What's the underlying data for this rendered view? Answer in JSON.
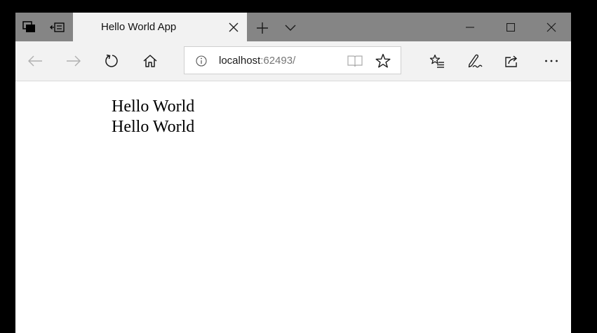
{
  "tab": {
    "title": "Hello World App"
  },
  "address": {
    "host": "localhost",
    "rest": ":62493/"
  },
  "content": {
    "lines": [
      "Hello World",
      "Hello World"
    ]
  },
  "icons": {
    "set_aside": "set-tabs-aside-icon",
    "preview": "show-tab-previews-icon",
    "close": "close-icon",
    "new_tab": "plus-icon",
    "tab_list": "chevron-down-icon",
    "minimize": "minimize-icon",
    "maximize": "maximize-icon",
    "window_close": "close-icon",
    "back": "back-arrow-icon",
    "forward": "forward-arrow-icon",
    "refresh": "refresh-icon",
    "home": "home-icon",
    "info": "info-icon",
    "reading_view": "reading-view-icon",
    "favorite": "star-icon",
    "hub": "favorites-hub-icon",
    "notes": "pen-icon",
    "share": "share-icon",
    "more": "more-icon"
  },
  "colors": {
    "tabstrip": "#858585",
    "active_tab": "#f2f2f2",
    "toolbar": "#f2f2f2",
    "desktop": "#000000"
  }
}
